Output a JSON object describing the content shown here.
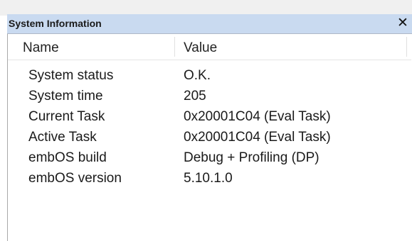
{
  "window": {
    "title": "System Information",
    "close_glyph": "✕"
  },
  "table": {
    "columns": [
      "Name",
      "Value"
    ],
    "rows": [
      {
        "name": "System status",
        "value": "O.K."
      },
      {
        "name": "System time",
        "value": "205"
      },
      {
        "name": "Current Task",
        "value": "0x20001C04 (Eval Task)"
      },
      {
        "name": "Active Task",
        "value": "0x20001C04 (Eval Task)"
      },
      {
        "name": "embOS build",
        "value": "Debug + Profiling (DP)"
      },
      {
        "name": "embOS version",
        "value": "5.10.1.0"
      }
    ]
  },
  "colors": {
    "titlebar_bg": "#c9daf0",
    "panel_bg": "#ffffff",
    "text": "#1a1a1a"
  }
}
